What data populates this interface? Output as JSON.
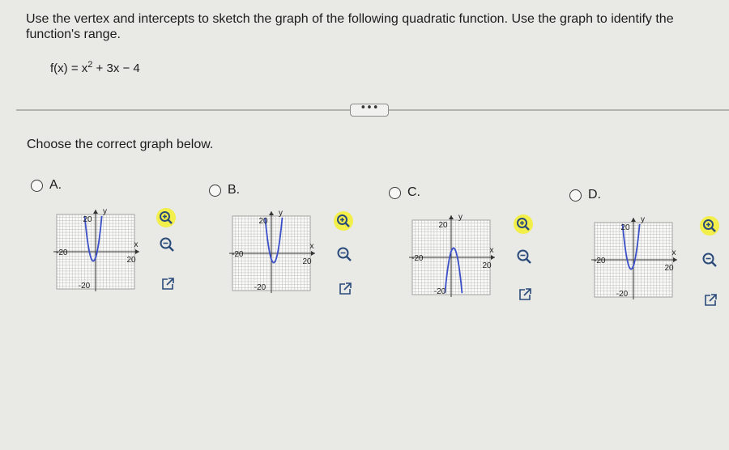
{
  "question": {
    "text": "Use the vertex and intercepts to sketch the graph of the following quadratic function. Use the graph to identify the function's range."
  },
  "function": {
    "lhs": "f(x) = x",
    "exponent": "2",
    "rhs": " + 3x − 4"
  },
  "more_button": {
    "label": "•••"
  },
  "prompt": "Choose the correct graph below.",
  "options": [
    {
      "letter": "A.",
      "xlabel": "x",
      "ylabel": "y",
      "ticks": {
        "top": "20",
        "bottom": "-20",
        "left": "-20",
        "right": "20"
      }
    },
    {
      "letter": "B.",
      "xlabel": "x",
      "ylabel": "y",
      "ticks": {
        "top": "20",
        "bottom": "-20",
        "left": "-20",
        "right": "20"
      }
    },
    {
      "letter": "C.",
      "xlabel": "x",
      "ylabel": "y",
      "ticks": {
        "top": "20",
        "bottom": "-20",
        "left": "-20",
        "right": "20"
      }
    },
    {
      "letter": "D.",
      "xlabel": "x",
      "ylabel": "y",
      "ticks": {
        "top": "20",
        "bottom": "-20",
        "left": "-20",
        "right": "20"
      }
    }
  ],
  "icons": {
    "zoom_in": "zoom-in-icon",
    "zoom_out": "zoom-out-icon",
    "popout": "popout-icon"
  },
  "colors": {
    "curve": "#3b4fc9",
    "zoom_bg": "#f2ef4a",
    "axis": "#333333",
    "grid": "#b5b5b5",
    "radio": "#3a3a3a"
  }
}
